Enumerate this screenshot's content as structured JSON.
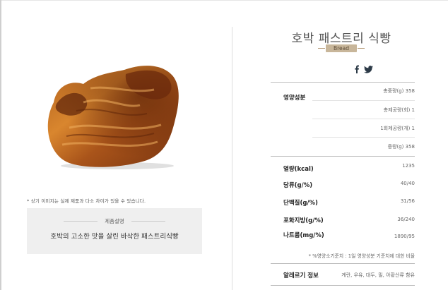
{
  "product": {
    "title": "호박 패스트리 식빵",
    "category": "Bread",
    "disclaimer": "* 상기 이미지는 실제 제품과 다소 차이가 있을 수 있습니다.",
    "description_label": "제품설명",
    "description": "호박의 고소한 맛을 살린 바삭한 패스트리식빵"
  },
  "social": {
    "icons": [
      "facebook-icon",
      "twitter-icon"
    ],
    "color": "#2c3a47"
  },
  "nutrition": {
    "section_label": "영양성분",
    "serving": [
      "총중량(g) 358",
      "총제공량(회) 1",
      "1회제공량(개) 1",
      "중량(g) 358"
    ],
    "rows": [
      {
        "label": "열량(kcal)",
        "value": "1235"
      },
      {
        "label": "당류(g/%)",
        "value": "40/40"
      },
      {
        "label": "단백질(g/%)",
        "value": "31/56"
      },
      {
        "label": "포화지방(g/%)",
        "value": "36/240"
      },
      {
        "label": "나트륨(mg/%)",
        "value": "1890/95"
      }
    ],
    "note": "* %영양소기준치 : 1일 영양성분 기준치에 대한 비율"
  },
  "allergy": {
    "label": "알레르기 정보",
    "value": "계란, 우유, 대두, 밀, 아황산류 함유"
  },
  "colors": {
    "badge": "#c8b69a",
    "panel": "#efefef",
    "divider": "#dcdcdc"
  }
}
